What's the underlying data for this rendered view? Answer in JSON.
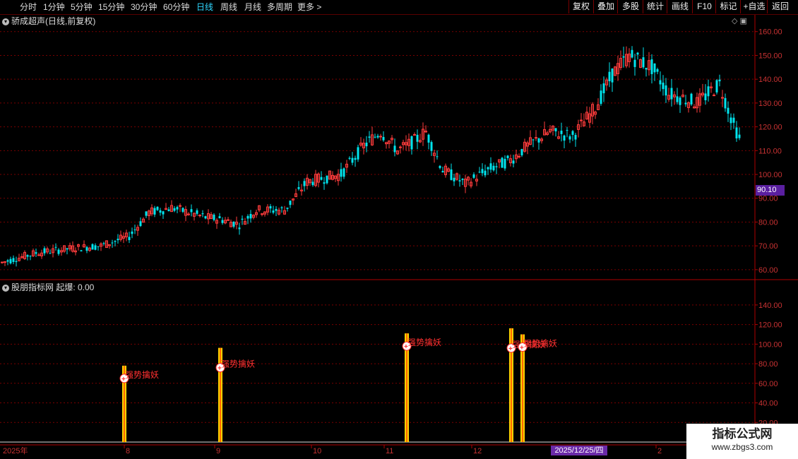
{
  "toolbar": {
    "left_items": [
      "分时",
      "1分钟",
      "5分钟",
      "15分钟",
      "30分钟",
      "60分钟",
      "日线",
      "周线",
      "月线",
      "多周期",
      "更多 >"
    ],
    "active_index": 6,
    "right_items": [
      "复权",
      "叠加",
      "多股",
      "统计",
      "画线",
      "F10",
      "标记",
      "+自选",
      "返回"
    ]
  },
  "main_panel": {
    "title": "骄成超声(日线,前复权)",
    "price_label": "90.10",
    "y_ticks": [
      "160.00",
      "150.00",
      "140.00",
      "130.00",
      "120.00",
      "110.00",
      "100.00",
      "90.00",
      "80.00",
      "70.00",
      "60.00"
    ]
  },
  "sub_panel": {
    "title": "股朋指标网 起爆: 0.00",
    "y_ticks": [
      "140.00",
      "120.00",
      "100.00",
      "80.00",
      "60.00",
      "40.00",
      "20.00"
    ],
    "signal_label": "强势擒妖"
  },
  "x_axis": {
    "labels": [
      "2025年",
      "8",
      "9",
      "10",
      "11",
      "12",
      "2"
    ],
    "cursor_date": "2025/12/25/四"
  },
  "watermark": {
    "line1": "指标公式网",
    "line2": "www.zbgs3.com"
  },
  "colors": {
    "up": "#ff3c3c",
    "down": "#00e5ee",
    "grid": "#7a0000",
    "signal": "#ffd200"
  },
  "chart_data": {
    "type": "candlestick",
    "y_range": [
      57,
      162
    ],
    "sub_y_range": [
      0,
      150
    ],
    "signals": [
      {
        "candle": 43,
        "value": 65
      },
      {
        "candle": 77,
        "value": 76
      },
      {
        "candle": 143,
        "value": 98
      },
      {
        "candle": 180,
        "value": 96
      },
      {
        "candle": 184,
        "value": 97
      }
    ]
  }
}
